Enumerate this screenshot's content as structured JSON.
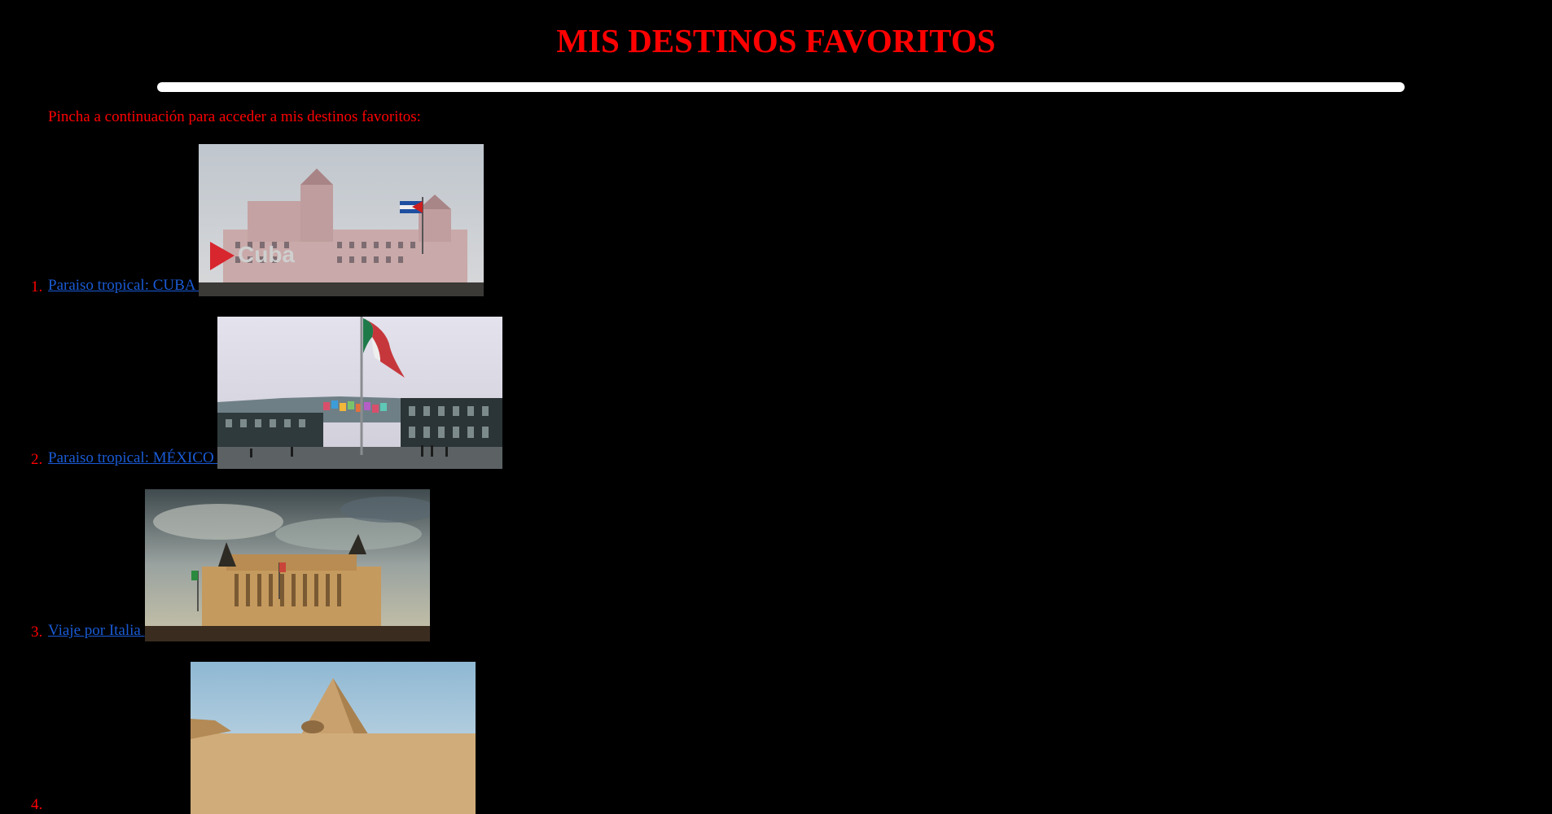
{
  "page": {
    "title": "MIS DESTINOS FAVORITOS",
    "intro": "Pincha a continuación para acceder a mis destinos favoritos:"
  },
  "destinations": [
    {
      "number": "1.",
      "label": "Paraiso tropical: CUBA ",
      "image": "havana-hotel-with-cuban-flag"
    },
    {
      "number": "2.",
      "label": "Paraiso tropical: MÉXICO ",
      "image": "mexico-city-zocalo-flag"
    },
    {
      "number": "3.",
      "label": "Viaje por Italia ",
      "image": "rome-vittoriano-monument"
    },
    {
      "number": "4.",
      "label": "",
      "image": "giza-pyramid-and-sphinx"
    }
  ],
  "colors": {
    "background": "#000000",
    "heading": "#ff0000",
    "link": "#1a5bd6",
    "divider": "#ffffff"
  }
}
